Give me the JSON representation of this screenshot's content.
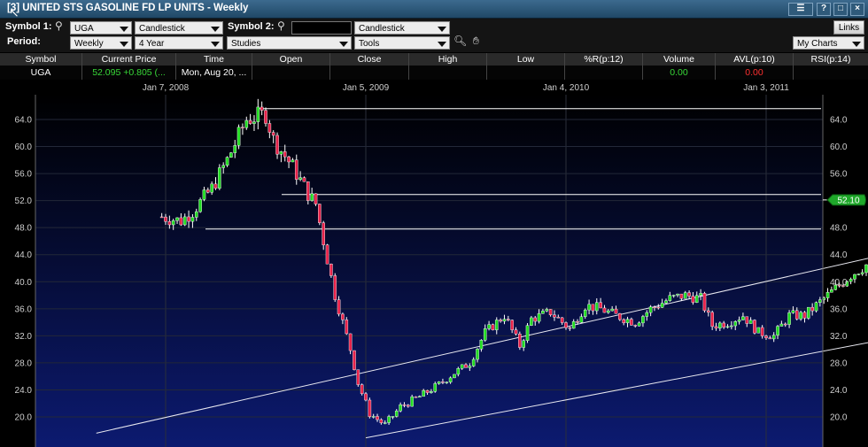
{
  "window": {
    "title": "[3] UNITED STS GASOLINE FD LP UNITS - Weekly",
    "buttons": [
      "☰",
      "?",
      "□",
      "×"
    ]
  },
  "toolbar": {
    "symbol1_label": "Symbol 1:",
    "symbol1_value": "UGA",
    "chart_type1": "Candlestick",
    "symbol2_label": "Symbol 2:",
    "symbol2_value": "",
    "chart_type2": "Candlestick",
    "period_label": "Period:",
    "period_value": "Weekly",
    "range_value": "4 Year",
    "studies": "Studies",
    "tools": "Tools",
    "links": "Links",
    "my_charts": "My Charts"
  },
  "quote": {
    "headers": [
      "Symbol",
      "Current Price",
      "Time",
      "Open",
      "Close",
      "High",
      "Low",
      "%R(p:12)",
      "Volume",
      "AVL(p:10)",
      "RSI(p:14)"
    ],
    "values": [
      "UGA",
      "52.095  +0.805 (...",
      "Mon, Aug 20, ...",
      "",
      "",
      "",
      "",
      "",
      "0.00",
      "0.00",
      ""
    ],
    "colors": {
      "green": "#38d838",
      "red": "#ff3030",
      "white": "#ffffff"
    }
  },
  "chart_data": {
    "type": "candlestick",
    "x_ticks": [
      "Jan 7, 2008",
      "Jan 5, 2009",
      "Jan 4, 2010",
      "Jan 3, 2011"
    ],
    "y_ticks": [
      "20.0",
      "24.0",
      "28.0",
      "32.0",
      "36.0",
      "40.0",
      "44.0",
      "48.0",
      "52.0",
      "56.0",
      "60.0",
      "64.0"
    ],
    "ylim": [
      17,
      67
    ],
    "last_price_label": "52.10",
    "last_price": 52.1,
    "colors": {
      "up": "#22dd22",
      "down": "#e8224a",
      "bg_top": "#000000",
      "bg_bottom": "#0c1a70",
      "last_tag": "#1fa82a"
    },
    "horizontal_lines": [
      65.6,
      52.9,
      47.8
    ],
    "trend_lines": [
      {
        "from": [
          "2007-09-03",
          17.6
        ],
        "to": [
          "2012-08-20",
          51.0
        ]
      },
      {
        "from": [
          "2009-01-05",
          16.9
        ],
        "to": [
          "2012-08-20",
          37.3
        ]
      }
    ],
    "close_path": [
      [
        "2007-12-31",
        49.6
      ],
      [
        "2008-02-04",
        49.0
      ],
      [
        "2008-02-25",
        50.4
      ],
      [
        "2008-03-31",
        53.8
      ],
      [
        "2008-04-28",
        58.0
      ],
      [
        "2008-06-02",
        64.0
      ],
      [
        "2008-07-07",
        64.8
      ],
      [
        "2008-07-21",
        61.0
      ],
      [
        "2008-08-25",
        57.0
      ],
      [
        "2008-09-22",
        53.0
      ],
      [
        "2008-10-06",
        51.5
      ],
      [
        "2008-10-20",
        46.0
      ],
      [
        "2008-11-10",
        38.0
      ],
      [
        "2008-12-08",
        30.0
      ],
      [
        "2008-12-22",
        25.0
      ],
      [
        "2009-01-12",
        20.5
      ],
      [
        "2009-02-09",
        18.8
      ],
      [
        "2009-03-09",
        21.5
      ],
      [
        "2009-04-13",
        23.0
      ],
      [
        "2009-05-18",
        24.8
      ],
      [
        "2009-06-15",
        26.5
      ],
      [
        "2009-07-13",
        28.0
      ],
      [
        "2009-08-10",
        32.5
      ],
      [
        "2009-09-14",
        35.0
      ],
      [
        "2009-10-12",
        30.5
      ],
      [
        "2009-11-02",
        34.5
      ],
      [
        "2009-12-07",
        35.5
      ],
      [
        "2010-01-11",
        33.0
      ],
      [
        "2010-02-08",
        36.5
      ],
      [
        "2010-03-08",
        36.0
      ],
      [
        "2010-04-05",
        35.0
      ],
      [
        "2010-05-10",
        34.0
      ],
      [
        "2010-06-07",
        36.0
      ],
      [
        "2010-07-12",
        37.5
      ],
      [
        "2010-08-09",
        38.0
      ],
      [
        "2010-09-06",
        37.5
      ],
      [
        "2010-09-27",
        33.5
      ],
      [
        "2010-10-25",
        34.0
      ],
      [
        "2010-11-22",
        35.0
      ],
      [
        "2010-12-20",
        32.5
      ],
      [
        "2011-01-17",
        32.0
      ],
      [
        "2011-02-14",
        35.0
      ],
      [
        "2011-03-14",
        35.0
      ],
      [
        "2011-04-11",
        37.0
      ],
      [
        "2011-05-09",
        39.0
      ],
      [
        "2011-06-06",
        41.0
      ],
      [
        "2011-07-04",
        42.5
      ],
      [
        "2011-08-01",
        42.0
      ],
      [
        "2011-09-12",
        46.0
      ],
      [
        "2011-10-10",
        49.5
      ],
      [
        "2011-11-07",
        48.5
      ],
      [
        "2011-12-05",
        50.5
      ],
      [
        "2012-01-09",
        51.0
      ],
      [
        "2012-02-06",
        52.5
      ]
    ]
  }
}
